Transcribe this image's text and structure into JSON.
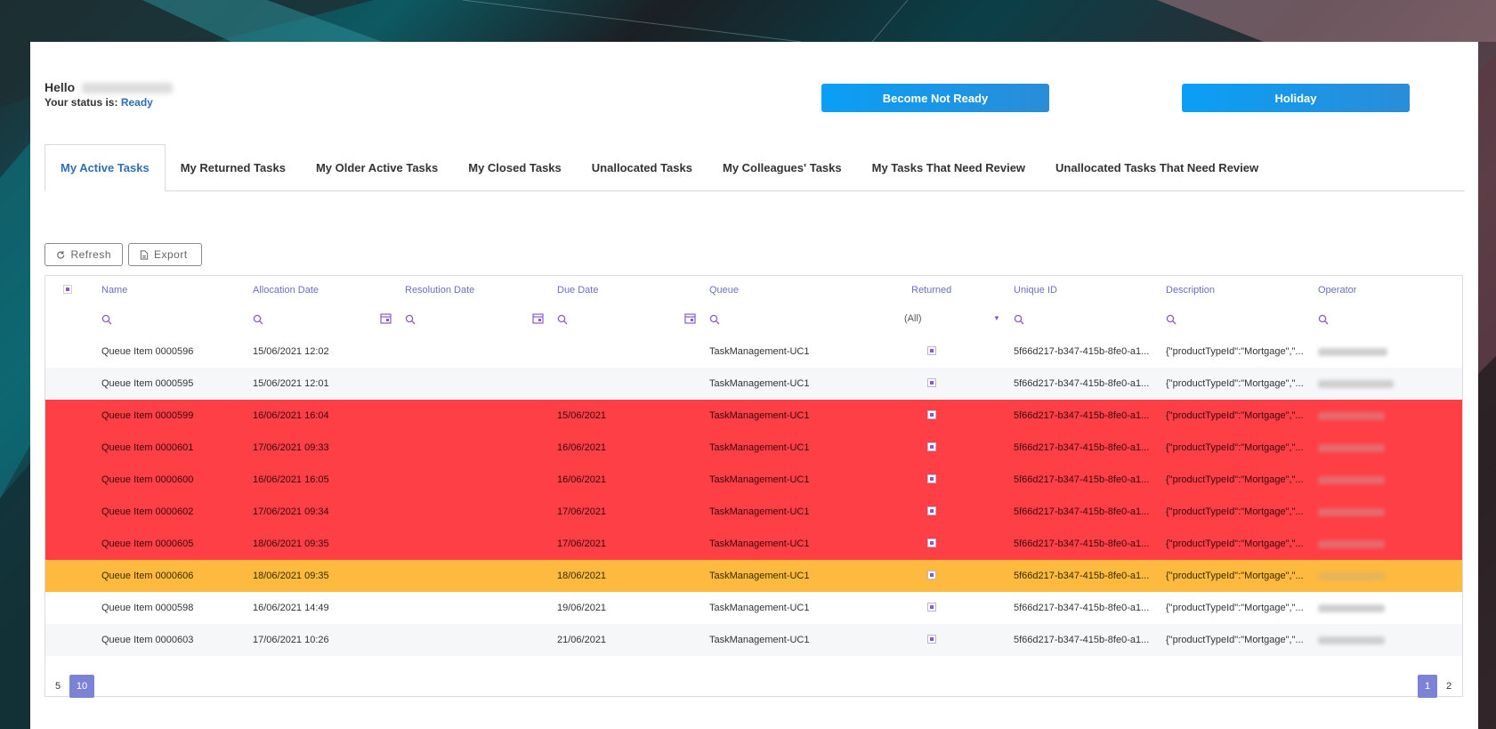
{
  "user": {
    "greeting": "Hello",
    "status_prefix": "Your status is:",
    "status_value": "Ready"
  },
  "actions": {
    "not_ready_label": "Become Not Ready",
    "holiday_label": "Holiday"
  },
  "tabs": [
    {
      "label": "My Active Tasks",
      "active": true
    },
    {
      "label": "My Returned Tasks"
    },
    {
      "label": "My Older Active Tasks"
    },
    {
      "label": "My Closed Tasks"
    },
    {
      "label": "Unallocated Tasks"
    },
    {
      "label": "My Colleagues' Tasks"
    },
    {
      "label": "My Tasks That Need Review"
    },
    {
      "label": "Unallocated Tasks That Need Review"
    }
  ],
  "toolbar": {
    "refresh_label": "Refresh",
    "export_label": "Export"
  },
  "grid": {
    "columns": [
      "Name",
      "Allocation Date",
      "Resolution Date",
      "Due Date",
      "Queue",
      "Returned",
      "Unique ID",
      "Description",
      "Operator"
    ],
    "returned_filter": "(All)",
    "rows": [
      {
        "name": "Queue Item 0000596",
        "allocation": "15/06/2021 12:02",
        "resolution": "",
        "due": "",
        "queue": "TaskManagement-UC1",
        "uid": "5f66d217-b347-415b-8fe0-a1...",
        "desc": "{\"productTypeId\":\"Mortgage\",\"...",
        "status": "normal"
      },
      {
        "name": "Queue Item 0000595",
        "allocation": "15/06/2021 12:01",
        "resolution": "",
        "due": "",
        "queue": "TaskManagement-UC1",
        "uid": "5f66d217-b347-415b-8fe0-a1...",
        "desc": "{\"productTypeId\":\"Mortgage\",\"...",
        "status": "normal"
      },
      {
        "name": "Queue Item 0000599",
        "allocation": "16/06/2021 16:04",
        "resolution": "",
        "due": "15/06/2021",
        "queue": "TaskManagement-UC1",
        "uid": "5f66d217-b347-415b-8fe0-a1...",
        "desc": "{\"productTypeId\":\"Mortgage\",\"...",
        "status": "overdue"
      },
      {
        "name": "Queue Item 0000601",
        "allocation": "17/06/2021 09:33",
        "resolution": "",
        "due": "16/06/2021",
        "queue": "TaskManagement-UC1",
        "uid": "5f66d217-b347-415b-8fe0-a1...",
        "desc": "{\"productTypeId\":\"Mortgage\",\"...",
        "status": "overdue"
      },
      {
        "name": "Queue Item 0000600",
        "allocation": "16/06/2021 16:05",
        "resolution": "",
        "due": "16/06/2021",
        "queue": "TaskManagement-UC1",
        "uid": "5f66d217-b347-415b-8fe0-a1...",
        "desc": "{\"productTypeId\":\"Mortgage\",\"...",
        "status": "overdue"
      },
      {
        "name": "Queue Item 0000602",
        "allocation": "17/06/2021 09:34",
        "resolution": "",
        "due": "17/06/2021",
        "queue": "TaskManagement-UC1",
        "uid": "5f66d217-b347-415b-8fe0-a1...",
        "desc": "{\"productTypeId\":\"Mortgage\",\"...",
        "status": "overdue"
      },
      {
        "name": "Queue Item 0000605",
        "allocation": "18/06/2021 09:35",
        "resolution": "",
        "due": "17/06/2021",
        "queue": "TaskManagement-UC1",
        "uid": "5f66d217-b347-415b-8fe0-a1...",
        "desc": "{\"productTypeId\":\"Mortgage\",\"...",
        "status": "overdue"
      },
      {
        "name": "Queue Item 0000606",
        "allocation": "18/06/2021 09:35",
        "resolution": "",
        "due": "18/06/2021",
        "queue": "TaskManagement-UC1",
        "uid": "5f66d217-b347-415b-8fe0-a1...",
        "desc": "{\"productTypeId\":\"Mortgage\",\"...",
        "status": "due-today"
      },
      {
        "name": "Queue Item 0000598",
        "allocation": "16/06/2021 14:49",
        "resolution": "",
        "due": "19/06/2021",
        "queue": "TaskManagement-UC1",
        "uid": "5f66d217-b347-415b-8fe0-a1...",
        "desc": "{\"productTypeId\":\"Mortgage\",\"...",
        "status": "normal"
      },
      {
        "name": "Queue Item 0000603",
        "allocation": "17/06/2021 10:26",
        "resolution": "",
        "due": "21/06/2021",
        "queue": "TaskManagement-UC1",
        "uid": "5f66d217-b347-415b-8fe0-a1...",
        "desc": "{\"productTypeId\":\"Mortgage\",\"...",
        "status": "normal"
      }
    ]
  },
  "pager": {
    "sizes": [
      "5",
      "10"
    ],
    "active_size": "10",
    "pages": [
      "1",
      "2"
    ],
    "active_page": "1"
  },
  "colors": {
    "accent": "#2f6eb5",
    "button": "#0a9ff5",
    "header_text": "#6b6fbd",
    "overdue": "#fe3f45",
    "due_today": "#fdba3f",
    "pager_active": "#7c83d4"
  }
}
